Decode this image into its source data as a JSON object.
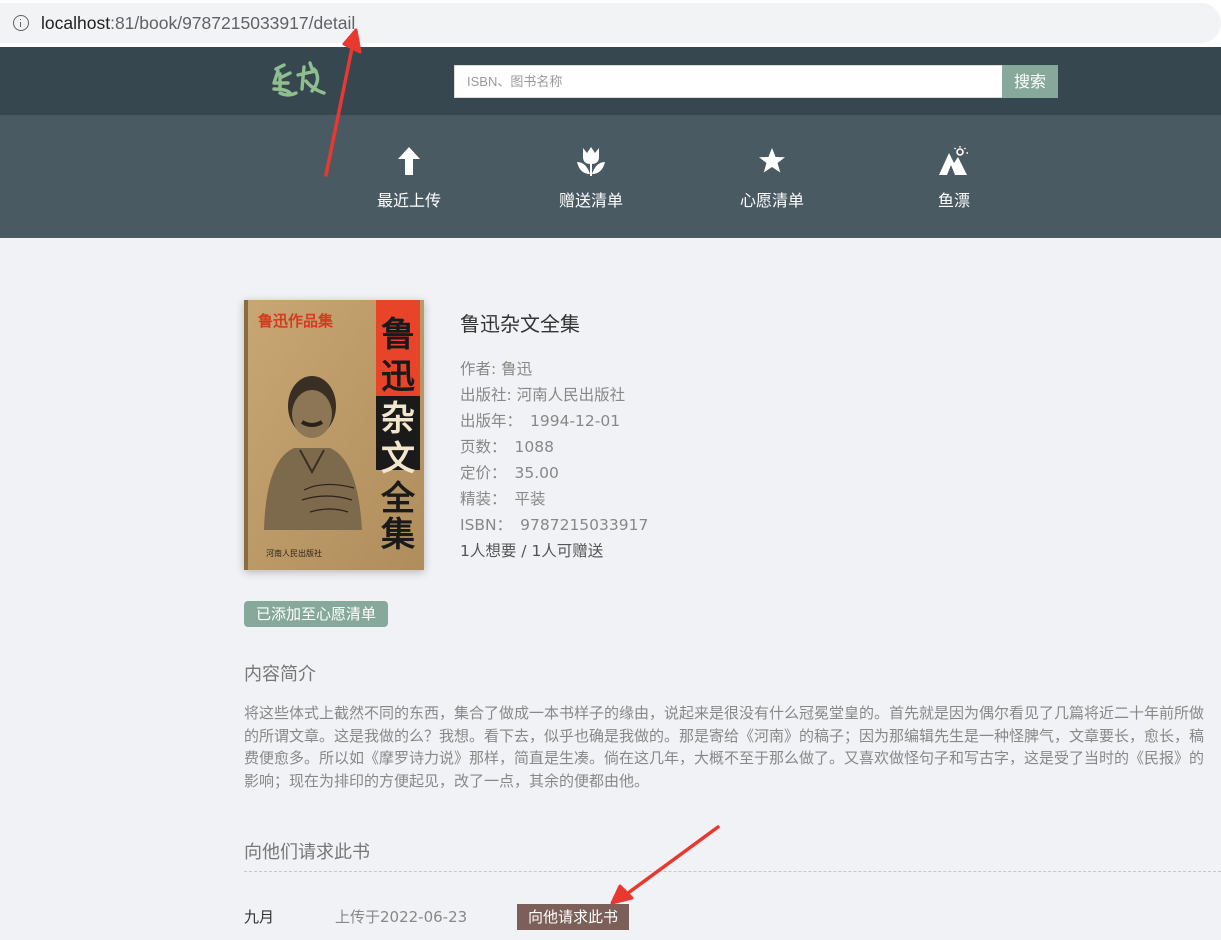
{
  "browser": {
    "url_host": "localhost",
    "url_rest": ":81/book/9787215033917/detail"
  },
  "header": {
    "logo_text": "鱼书",
    "search_placeholder": "ISBN、图书名称",
    "search_button": "搜索"
  },
  "nav": {
    "items": [
      {
        "label": "最近上传",
        "icon": "upload-arrow-icon"
      },
      {
        "label": "赠送清单",
        "icon": "tulip-icon"
      },
      {
        "label": "心愿清单",
        "icon": "star-icon"
      },
      {
        "label": "鱼漂",
        "icon": "mountain-sun-icon"
      }
    ]
  },
  "book": {
    "title": "鲁迅杂文全集",
    "author_label": "作者:",
    "author": "鲁迅",
    "publisher_label": "出版社:",
    "publisher": "河南人民出版社",
    "pubdate_label": "出版年：",
    "pubdate": "1994-12-01",
    "pages_label": "页数：",
    "pages": "1088",
    "price_label": "定价：",
    "price": "35.00",
    "binding_label": "精装：",
    "binding": "平装",
    "isbn_label": "ISBN：",
    "isbn": "9787215033917",
    "counts": "1人想要 / 1人可赠送",
    "cover": {
      "series_text": "鲁迅作品集",
      "title_chars": [
        "鲁",
        "迅",
        "杂",
        "文",
        "全",
        "集"
      ],
      "publisher_text": "河南人民出版社"
    }
  },
  "wish_badge": "已添加至心愿清单",
  "summary_title": "内容简介",
  "summary": "将这些体式上截然不同的东西，集合了做成一本书样子的缘由，说起来是很没有什么冠冕堂皇的。首先就是因为偶尔看见了几篇将近二十年前所做的所谓文章。这是我做的么？我想。看下去，似乎也确是我做的。那是寄给《河南》的稿子；因为那编辑先生是一种怪脾气，文章要长，愈长，稿费便愈多。所以如《摩罗诗力说》那样，简直是生凑。倘在这几年，大概不至于那么做了。又喜欢做怪句子和写古字，这是受了当时的《民报》的影响；现在为排印的方便起见，改了一点，其余的便都由他。",
  "request": {
    "section_title": "向他们请求此书",
    "rows": [
      {
        "user": "九月",
        "date": "上传于2022-06-23",
        "button": "向他请求此书"
      }
    ]
  },
  "colors": {
    "topbar": "#37474f",
    "navbar": "#4a5a63",
    "accent_green": "#86a99b",
    "request_brown": "#7c5f58",
    "annotation_red": "#e8382f"
  }
}
